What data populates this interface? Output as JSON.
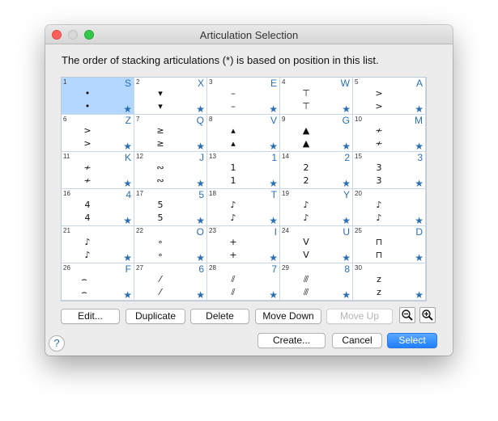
{
  "window": {
    "title": "Articulation Selection"
  },
  "instruction": "The order of stacking articulations (*) is based on position in this list.",
  "cells": [
    {
      "num": "1",
      "key": "S",
      "glyph": "•",
      "selected": true
    },
    {
      "num": "2",
      "key": "X",
      "glyph": "▾",
      "selected": false
    },
    {
      "num": "3",
      "key": "E",
      "glyph": "–",
      "selected": false
    },
    {
      "num": "4",
      "key": "W",
      "glyph": "⊤",
      "selected": false
    },
    {
      "num": "5",
      "key": "A",
      "glyph": ">",
      "selected": false
    },
    {
      "num": "6",
      "key": "Z",
      "glyph": ">",
      "selected": false
    },
    {
      "num": "7",
      "key": "Q",
      "glyph": "≥",
      "selected": false
    },
    {
      "num": "8",
      "key": "V",
      "glyph": "▴",
      "selected": false
    },
    {
      "num": "9",
      "key": "G",
      "glyph": "▲",
      "selected": false
    },
    {
      "num": "10",
      "key": "M",
      "glyph": "≁",
      "selected": false
    },
    {
      "num": "11",
      "key": "K",
      "glyph": "≁",
      "selected": false
    },
    {
      "num": "12",
      "key": "J",
      "glyph": "∾",
      "selected": false
    },
    {
      "num": "13",
      "key": "1",
      "glyph": "1",
      "selected": false
    },
    {
      "num": "14",
      "key": "2",
      "glyph": "2",
      "selected": false
    },
    {
      "num": "15",
      "key": "3",
      "glyph": "3",
      "selected": false
    },
    {
      "num": "16",
      "key": "4",
      "glyph": "4",
      "selected": false
    },
    {
      "num": "17",
      "key": "5",
      "glyph": "5",
      "selected": false
    },
    {
      "num": "18",
      "key": "T",
      "glyph": "♪",
      "selected": false
    },
    {
      "num": "19",
      "key": "Y",
      "glyph": "♪",
      "selected": false
    },
    {
      "num": "20",
      "key": "",
      "glyph": "♪",
      "selected": false
    },
    {
      "num": "21",
      "key": "",
      "glyph": "♪",
      "selected": false
    },
    {
      "num": "22",
      "key": "O",
      "glyph": "∘",
      "selected": false
    },
    {
      "num": "23",
      "key": "I",
      "glyph": "+",
      "selected": false
    },
    {
      "num": "24",
      "key": "U",
      "glyph": "V",
      "selected": false
    },
    {
      "num": "25",
      "key": "D",
      "glyph": "⊓",
      "selected": false
    },
    {
      "num": "26",
      "key": "F",
      "glyph": "⌢",
      "selected": false
    },
    {
      "num": "27",
      "key": "6",
      "glyph": "⁄",
      "selected": false
    },
    {
      "num": "28",
      "key": "7",
      "glyph": "⫽",
      "selected": false
    },
    {
      "num": "29",
      "key": "8",
      "glyph": "⫻",
      "selected": false
    },
    {
      "num": "30",
      "key": "",
      "glyph": "z",
      "selected": false
    }
  ],
  "buttons": {
    "edit": "Edit...",
    "duplicate": "Duplicate",
    "delete": "Delete",
    "move_down": "Move Down",
    "move_up": "Move Up",
    "create": "Create...",
    "cancel": "Cancel",
    "select": "Select"
  },
  "icons": {
    "zoom_out": "zoom-out-icon",
    "zoom_in": "zoom-in-icon",
    "help": "?"
  },
  "colors": {
    "accent": "#1f7fff",
    "selection": "#b4d7ff",
    "key_blue": "#2a6fb5"
  }
}
